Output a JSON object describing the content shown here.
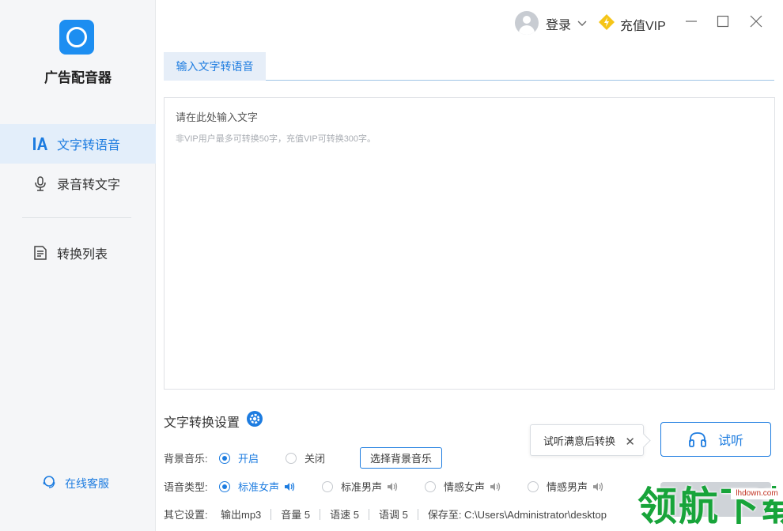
{
  "app": {
    "name": "广告配音器"
  },
  "sidebar": {
    "items": [
      {
        "label": "文字转语音",
        "icon": "text-a-icon",
        "active": true
      },
      {
        "label": "录音转文字",
        "icon": "microphone-icon",
        "active": false
      },
      {
        "label": "转换列表",
        "icon": "list-doc-icon",
        "active": false
      }
    ],
    "service": "在线客服"
  },
  "titlebar": {
    "login": "登录",
    "vip": "充值VIP"
  },
  "tabs": [
    {
      "label": "输入文字转语音",
      "active": true
    }
  ],
  "editor": {
    "placeholder": "请在此处输入文字",
    "hint": "非VIP用户最多可转换50字，充值VIP可转换300字。"
  },
  "settings": {
    "title": "文字转换设置",
    "bg_music": {
      "label": "背景音乐:",
      "options": [
        "开启",
        "关闭"
      ],
      "selected": "开启",
      "button": "选择背景音乐"
    },
    "voice_type": {
      "label": "语音类型:",
      "options": [
        "标准女声",
        "标准男声",
        "情感女声",
        "情感男声"
      ],
      "selected": "标准女声"
    },
    "other": {
      "label": "其它设置:",
      "output": "输出mp3",
      "volume": "音量 5",
      "speed": "语速 5",
      "tone": "语调 5",
      "save_to": "保存至: C:\\Users\\Administrator\\desktop"
    }
  },
  "tooltip": {
    "text": "试听满意后转换"
  },
  "buttons": {
    "listen": "试听"
  },
  "watermark": {
    "text": "领航下载",
    "url": "lhdown.com"
  },
  "colors": {
    "accent": "#1d7ce0",
    "sidebar_bg": "#f5f6f8",
    "vip_yellow": "#f5c518",
    "watermark_green": "#18a43a"
  }
}
